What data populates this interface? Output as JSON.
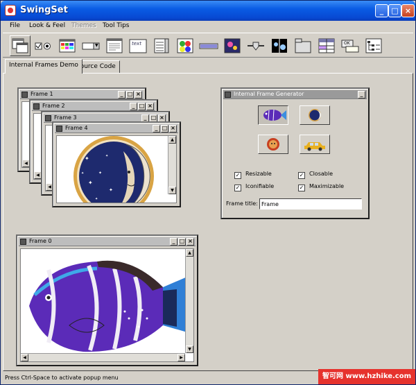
{
  "app": {
    "title": "SwingSet",
    "window_buttons": {
      "minimize": "_",
      "maximize": "□",
      "close": "×"
    }
  },
  "menu": [
    {
      "label": "File",
      "disabled": false
    },
    {
      "label": "Look & Feel",
      "disabled": false
    },
    {
      "label": "Themes",
      "disabled": true
    },
    {
      "label": "Tool Tips",
      "disabled": false
    }
  ],
  "toolbar": {
    "items": [
      "internal-frames-icon",
      "checkbox-radio-icon",
      "color-chooser-icon",
      "combobox-icon",
      "file-chooser-icon",
      "editor-pane-icon",
      "list-icon",
      "option-pane-icon",
      "progress-bar-icon",
      "scroll-pane-icon",
      "slider-icon",
      "split-pane-icon",
      "tabbed-pane-icon",
      "table-icon",
      "tooltip-icon",
      "tree-icon"
    ],
    "selected_index": 0,
    "combo_arrow": "▼",
    "text_tool_label": "text",
    "tooltip_tool_label": "OK"
  },
  "tabs": [
    {
      "label": "Internal Frames Demo",
      "active": true
    },
    {
      "label": "Source Code",
      "active": false
    }
  ],
  "frames": {
    "frame1": {
      "title": "Frame 1"
    },
    "frame2": {
      "title": "Frame 2"
    },
    "frame3": {
      "title": "Frame 3"
    },
    "frame4": {
      "title": "Frame 4",
      "image": "moon-image"
    },
    "frame0": {
      "title": "Frame 0",
      "image": "fish-image"
    }
  },
  "frame_buttons": {
    "minimize": "_",
    "maximize": "□",
    "close": "×"
  },
  "scroll_arrows": {
    "up": "▲",
    "down": "▼",
    "left": "◀",
    "right": "▶"
  },
  "generator": {
    "title": "Internal Frame Generator",
    "image_buttons": [
      "fish-icon",
      "moon-icon",
      "sun-icon",
      "taxi-icon"
    ],
    "checkboxes": [
      {
        "label": "Resizable",
        "checked": true
      },
      {
        "label": "Closable",
        "checked": true
      },
      {
        "label": "Iconifiable",
        "checked": true
      },
      {
        "label": "Maximizable",
        "checked": true
      }
    ],
    "check_mark": "✓",
    "frame_title_label": "Frame title:",
    "frame_title_value": "Frame"
  },
  "status": "Press Ctrl-Space to activate popup menu",
  "watermark": "智可网 www.hzhike.com",
  "colors": {
    "titlebar": "#0a5ce4",
    "fish_purple": "#5b2bb8",
    "moon_navy": "#1e2a6e",
    "moon_ring": "#d9a444"
  }
}
